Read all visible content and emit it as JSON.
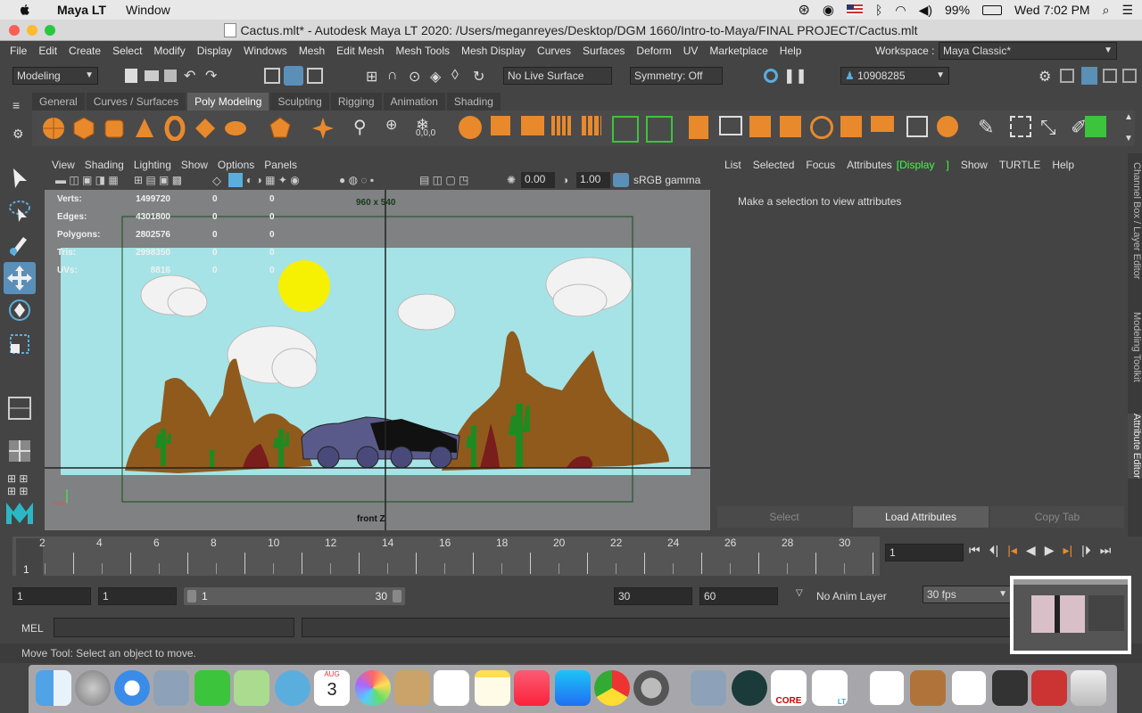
{
  "macbar": {
    "app_name": "Maya LT",
    "menus": [
      "Window"
    ],
    "battery": "99%",
    "clock": "Wed 7:02 PM"
  },
  "titlebar": {
    "title": "Cactus.mlt* - Autodesk Maya LT 2020: /Users/meganreyes/Desktop/DGM 1660/Intro-to-Maya/FINAL PROJECT/Cactus.mlt"
  },
  "menu": {
    "items": [
      "File",
      "Edit",
      "Create",
      "Select",
      "Modify",
      "Display",
      "Windows",
      "Mesh",
      "Edit Mesh",
      "Mesh Tools",
      "Mesh Display",
      "Curves",
      "Surfaces",
      "Deform",
      "UV",
      "Marketplace",
      "Help"
    ],
    "workspace_label": "Workspace :",
    "workspace_value": "Maya Classic*"
  },
  "status": {
    "mode": "Modeling",
    "live_surface": "No Live Surface",
    "symmetry": "Symmetry: Off",
    "user_id": "10908285"
  },
  "shelf": {
    "tabs": [
      "General",
      "Curves / Surfaces",
      "Poly Modeling",
      "Sculpting",
      "Rigging",
      "Animation",
      "Shading"
    ],
    "active_tab": "Poly Modeling",
    "pivot_label": "0,0,0"
  },
  "viewport": {
    "menus": [
      "View",
      "Shading",
      "Lighting",
      "Show",
      "Options",
      "Panels"
    ],
    "exposure": "0.00",
    "gamma": "1.00",
    "color_space": "sRGB gamma",
    "resolution": "960 x 540",
    "camera_label": "front Z",
    "hud": [
      {
        "label": "Verts:",
        "a": "1499720",
        "b": "0",
        "c": "0"
      },
      {
        "label": "Edges:",
        "a": "4301800",
        "b": "0",
        "c": "0"
      },
      {
        "label": "Polygons:",
        "a": "2802576",
        "b": "0",
        "c": "0"
      },
      {
        "label": "Tris:",
        "a": "2998350",
        "b": "0",
        "c": "0"
      },
      {
        "label": "UVs:",
        "a": "8816",
        "b": "0",
        "c": "0"
      }
    ]
  },
  "attr": {
    "tabs": [
      "List",
      "Selected",
      "Focus",
      "Attributes",
      "Display",
      "Show",
      "TURTLE",
      "Help"
    ],
    "active_tab": "Display",
    "message": "Make a selection to view attributes",
    "select_btn": "Select",
    "load_btn": "Load Attributes",
    "copy_btn": "Copy Tab",
    "side_tabs": [
      "Channel Box / Layer Editor",
      "Modeling Toolkit",
      "Attribute Editor"
    ]
  },
  "timeline": {
    "ticks": [
      "2",
      "4",
      "6",
      "8",
      "10",
      "12",
      "14",
      "16",
      "18",
      "20",
      "22",
      "24",
      "26",
      "28",
      "30"
    ],
    "current_frame_marker": "1",
    "current_frame": "1"
  },
  "range": {
    "start": "1",
    "playback_start": "1",
    "slider_start": "1",
    "slider_end": "30",
    "playback_end": "30",
    "end": "60",
    "anim_layer": "No Anim Layer",
    "fps": "30 fps"
  },
  "mel": {
    "label": "MEL"
  },
  "help": {
    "text": "Move Tool: Select an object to move."
  },
  "dock": {
    "calendar_month": "AUG",
    "calendar_day": "3",
    "core_label": "CORE",
    "mlt_label": "LT"
  },
  "colors": {
    "sky": "#a6e3e6",
    "sun": "#f6f003",
    "rock": "#8f5a1c",
    "cactus": "#1f8a22",
    "accent_green": "#3cff3c"
  }
}
